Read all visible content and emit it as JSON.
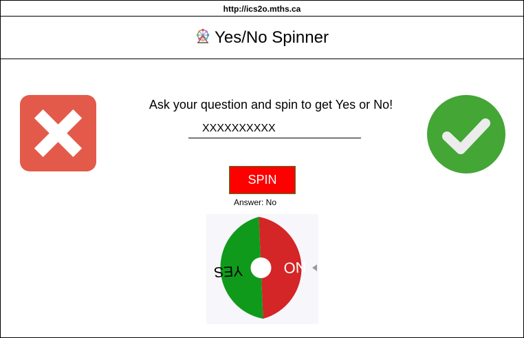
{
  "browser": {
    "url": "http://ics2o.mths.ca"
  },
  "header": {
    "title": "Yes/No Spinner",
    "title_icon": "ferris-wheel-icon"
  },
  "icons": {
    "no": {
      "name": "x-mark-icon",
      "color": "#e35a4b"
    },
    "yes": {
      "name": "check-mark-icon",
      "color": "#43a635"
    }
  },
  "main": {
    "prompt": "Ask your question and spin to get Yes or No!",
    "question_value": "XXXXXXXXXX",
    "spin_label": "SPIN",
    "answer_text": "Answer: No"
  },
  "wheel": {
    "yes_label": "YES",
    "no_label": "NO",
    "colors": {
      "yes": "#109a1c",
      "no": "#d42527",
      "pointer": "#9a9a9a"
    }
  }
}
